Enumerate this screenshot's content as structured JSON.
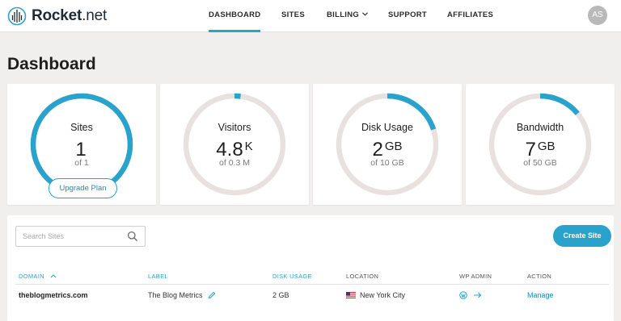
{
  "brand": {
    "name_bold": "Rocket",
    "name_rest": ".net"
  },
  "nav": {
    "items": [
      {
        "label": "DASHBOARD",
        "active": true
      },
      {
        "label": "SITES"
      },
      {
        "label": "BILLING",
        "has_dropdown": true
      },
      {
        "label": "SUPPORT"
      },
      {
        "label": "AFFILIATES"
      }
    ],
    "avatar_initials": "AS"
  },
  "page": {
    "title": "Dashboard"
  },
  "stats": [
    {
      "label": "Sites",
      "value": "1",
      "unit": "",
      "sub": "of 1",
      "progress": 1.0,
      "button": "Upgrade Plan"
    },
    {
      "label": "Visitors",
      "value": "4.8",
      "unit": "K",
      "sub": "of 0.3 M",
      "progress": 0.02
    },
    {
      "label": "Disk Usage",
      "value": "2",
      "unit": "GB",
      "sub": "of 10 GB",
      "progress": 0.2
    },
    {
      "label": "Bandwidth",
      "value": "7",
      "unit": "GB",
      "sub": "of 50 GB",
      "progress": 0.14
    }
  ],
  "sites_panel": {
    "search_placeholder": "Search Sites",
    "create_label": "Create Site",
    "columns": {
      "domain": "DOMAIN",
      "label": "LABEL",
      "disk": "DISK USAGE",
      "location": "LOCATION",
      "wp_admin": "WP ADMIN",
      "action": "ACTION"
    },
    "rows": [
      {
        "domain": "theblogmetrics.com",
        "label": "The Blog Metrics",
        "disk": "2 GB",
        "location": "New York City",
        "action": "Manage"
      }
    ]
  },
  "colors": {
    "accent": "#2aa3cc",
    "track": "#e8e1e0",
    "background": "#f1eeee"
  },
  "icons": {
    "logo": "rocket-logo-icon",
    "search": "search-icon",
    "edit": "pencil-icon",
    "flag": "us-flag-icon",
    "wordpress": "wordpress-icon",
    "login": "arrow-right-icon",
    "sort": "sort-asc-icon",
    "dropdown": "chevron-down-icon"
  }
}
